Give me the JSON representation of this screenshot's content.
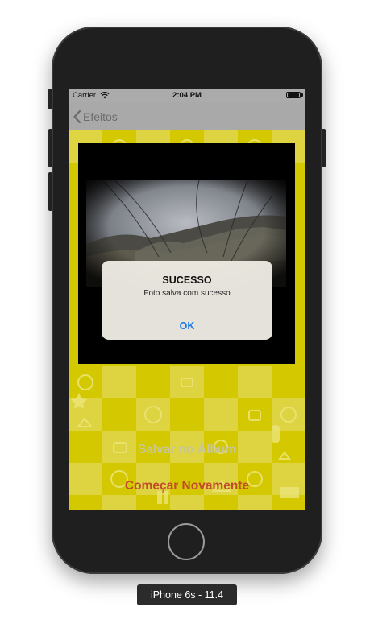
{
  "status_bar": {
    "carrier": "Carrier",
    "time": "2:04 PM"
  },
  "nav": {
    "back_label": "Efeitos"
  },
  "alert": {
    "title": "SUCESSO",
    "message": "Foto salva com sucesso",
    "ok_label": "OK"
  },
  "actions": {
    "save_label": "Salvar no Álbum",
    "restart_label": "Começar Novamente"
  },
  "device": {
    "label": "iPhone 6s - 11.4"
  },
  "colors": {
    "background_yellow": "#d4c900",
    "accent_blue": "#1a7ae6",
    "restart_red": "#c44a2e"
  }
}
